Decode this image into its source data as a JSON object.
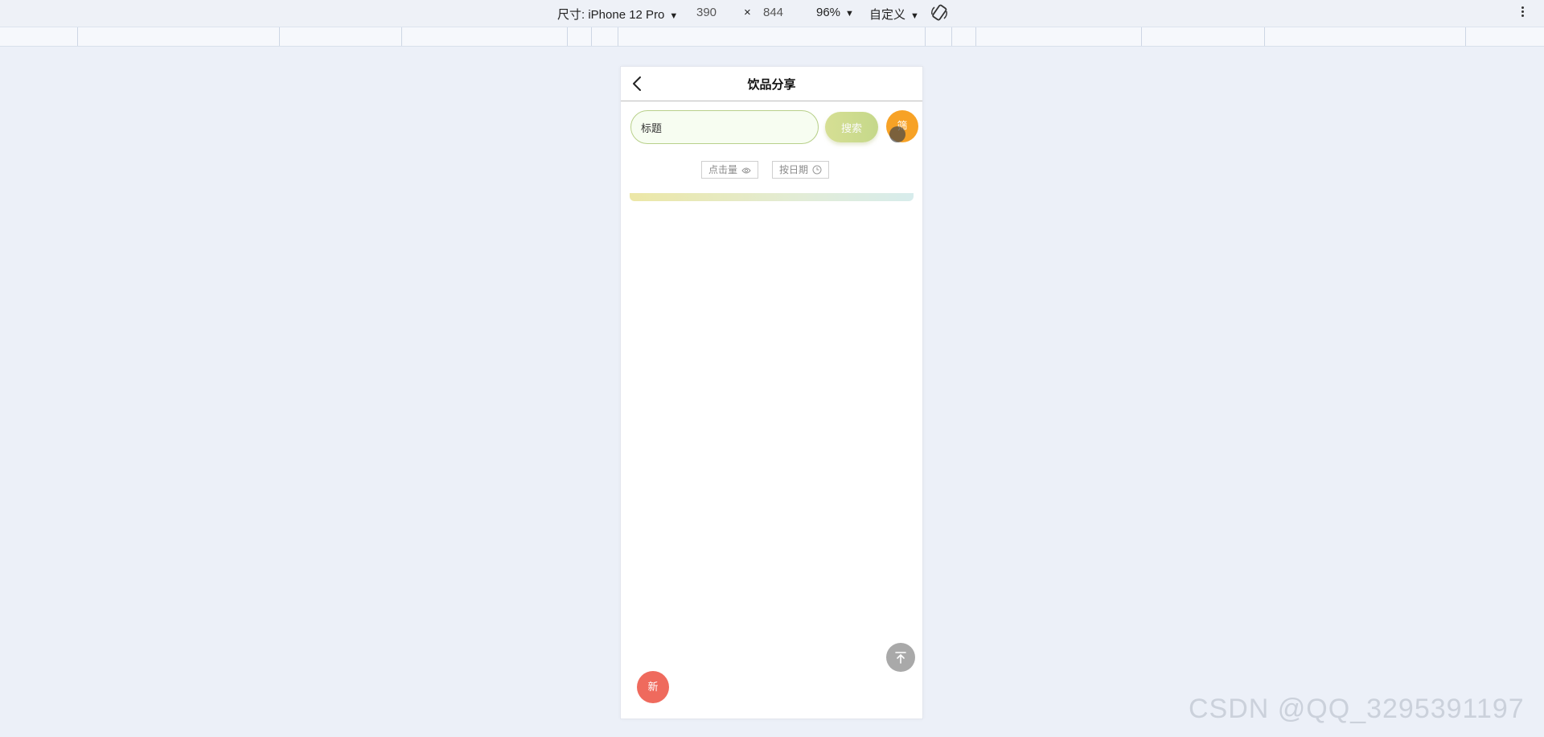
{
  "devtools": {
    "size_label": "尺寸: iPhone 12 Pro",
    "width": "390",
    "times": "×",
    "height": "844",
    "zoom": "96%",
    "throttle": "自定义",
    "caret": "▼"
  },
  "app": {
    "title": "饮品分享",
    "search": {
      "value": "标题",
      "placeholder": "标题"
    },
    "search_button": "搜索",
    "filter_button": "筛",
    "sort": {
      "clicks": "点击量",
      "date": "按日期"
    },
    "new_button": "新"
  },
  "watermark": "CSDN @QQ_3295391197",
  "icons": {
    "back": "chevron-left-icon",
    "eye": "eye-icon",
    "clock": "clock-icon",
    "back_to_top": "arrow-up-icon",
    "rotate": "rotate-device-icon",
    "more": "kebab-menu-icon"
  },
  "colors": {
    "filter": "#f7a226",
    "new": "#ef6a5d",
    "search_button": "#d6df94",
    "back_to_top": "#a9a9a9"
  }
}
